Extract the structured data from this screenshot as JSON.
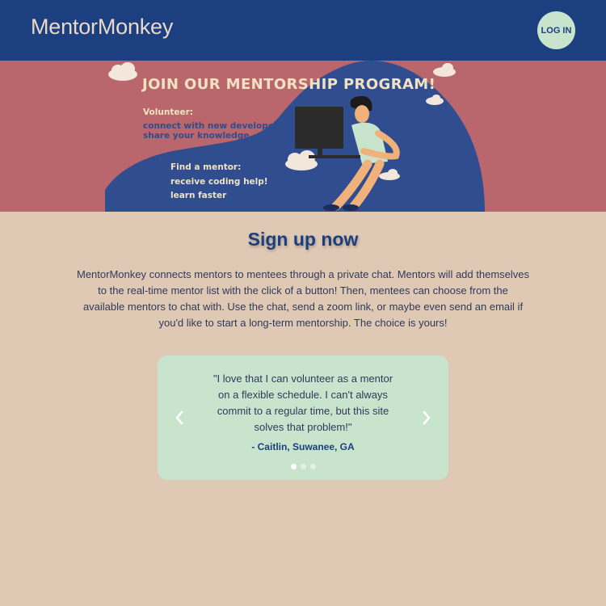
{
  "header": {
    "brand": "MentorMonkey",
    "login_label": "LOG IN"
  },
  "banner": {
    "title": "JOIN OUR MENTORSHIP PROGRAM!",
    "volunteer": {
      "heading": "Volunteer:",
      "lines": [
        "connect with new developers",
        "share your knowledge"
      ]
    },
    "mentor": {
      "heading": "Find a mentor:",
      "lines": [
        "receive coding help!",
        "learn faster"
      ]
    }
  },
  "main": {
    "title": "Sign up now",
    "intro": "MentorMonkey connects mentors to mentees through a private chat. Mentors will add themselves to the real-time mentor list with the click of a button! Then, mentees can choose from the available mentors to chat with. Use the chat, send a zoom link, or maybe even send an email if you'd like to start a long-term mentorship. The choice is yours!"
  },
  "carousel": {
    "quote": "\"I love that I can volunteer as a mentor on a flexible schedule. I can't always commit to a regular time, but this site solves that problem!\"",
    "author": "- Caitlin, Suwanee, GA",
    "slide_count": 3,
    "active_slide": 1,
    "prev_icon": "chevron-left-icon",
    "next_icon": "chevron-right-icon"
  },
  "colors": {
    "header_bg": "#1c3f80",
    "banner_bg": "#b9666d",
    "page_bg": "#dfc9b4",
    "carousel_bg": "#c9e4cc",
    "login_bg": "#c8e4cd"
  }
}
